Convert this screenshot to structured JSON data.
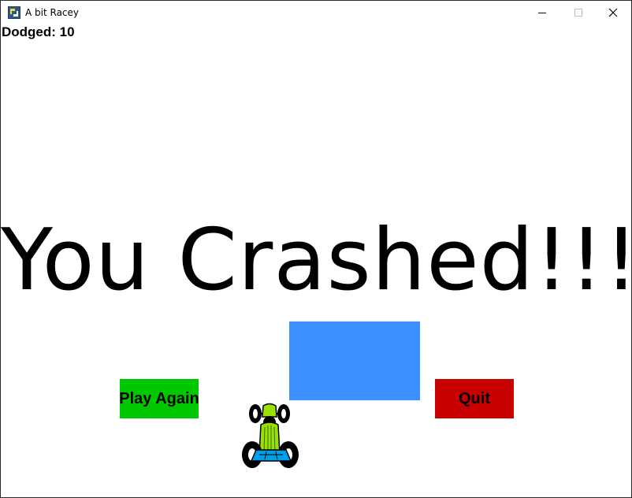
{
  "window": {
    "title": "A bit Racey",
    "minimize_icon": "minimize-icon",
    "maximize_icon": "maximize-icon",
    "close_icon": "close-icon"
  },
  "game": {
    "score_text": "Dodged: 10",
    "message": "You Crashed!!!",
    "buttons": {
      "play_again": "Play Again",
      "quit": "Quit"
    },
    "colors": {
      "play_button": "#00c800",
      "quit_button": "#c80000",
      "obstacle": "#3a90ff",
      "car_body": "#9be000",
      "car_base": "#00a0e8",
      "background": "#ffffff"
    }
  }
}
